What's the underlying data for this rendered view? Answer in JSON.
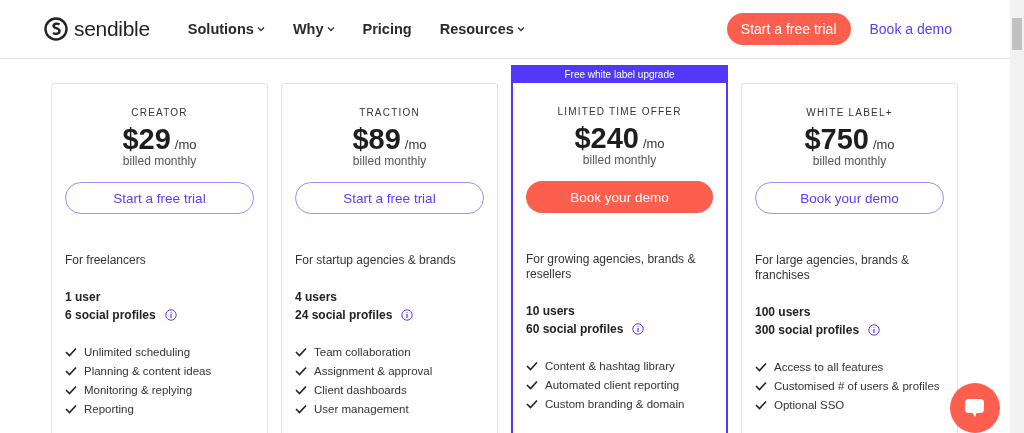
{
  "header": {
    "logo": "sendible",
    "nav": [
      {
        "label": "Solutions",
        "dropdown": true
      },
      {
        "label": "Why",
        "dropdown": true
      },
      {
        "label": "Pricing",
        "dropdown": false
      },
      {
        "label": "Resources",
        "dropdown": true
      }
    ],
    "trial_button": "Start a free trial",
    "demo_link": "Book a demo"
  },
  "plans": [
    {
      "tier": "CREATOR",
      "price": "$29",
      "period": "/mo",
      "billing": "billed monthly",
      "button": {
        "label": "Start a free trial",
        "primary": false
      },
      "description": "For freelancers",
      "users": "1 user",
      "profiles": "6 social profiles",
      "features": [
        "Unlimited scheduling",
        "Planning & content ideas",
        "Monitoring & replying",
        "Reporting"
      ]
    },
    {
      "tier": "TRACTION",
      "price": "$89",
      "period": "/mo",
      "billing": "billed monthly",
      "button": {
        "label": "Start a free trial",
        "primary": false
      },
      "description": "For startup agencies & brands",
      "users": "4 users",
      "profiles": "24 social profiles",
      "features": [
        "Team collaboration",
        "Assignment & approval",
        "Client dashboards",
        "User management"
      ]
    },
    {
      "tier": "LIMITED TIME OFFER",
      "banner": "Free white label upgrade",
      "price": "$240",
      "period": "/mo",
      "billing": "billed monthly",
      "button": {
        "label": "Book your demo",
        "primary": true
      },
      "description": "For growing agencies, brands & resellers",
      "users": "10 users",
      "profiles": "60 social profiles",
      "features": [
        "Content & hashtag library",
        "Automated client reporting",
        "Custom branding & domain"
      ]
    },
    {
      "tier": "WHITE LABEL+",
      "price": "$750",
      "period": "/mo",
      "billing": "billed monthly",
      "button": {
        "label": "Book your demo",
        "primary": false
      },
      "description": "For large agencies, brands & franchises",
      "users": "100 users",
      "profiles": "300 social profiles",
      "features": [
        "Access to all features",
        "Customised # of users & profiles",
        "Optional SSO"
      ]
    }
  ]
}
